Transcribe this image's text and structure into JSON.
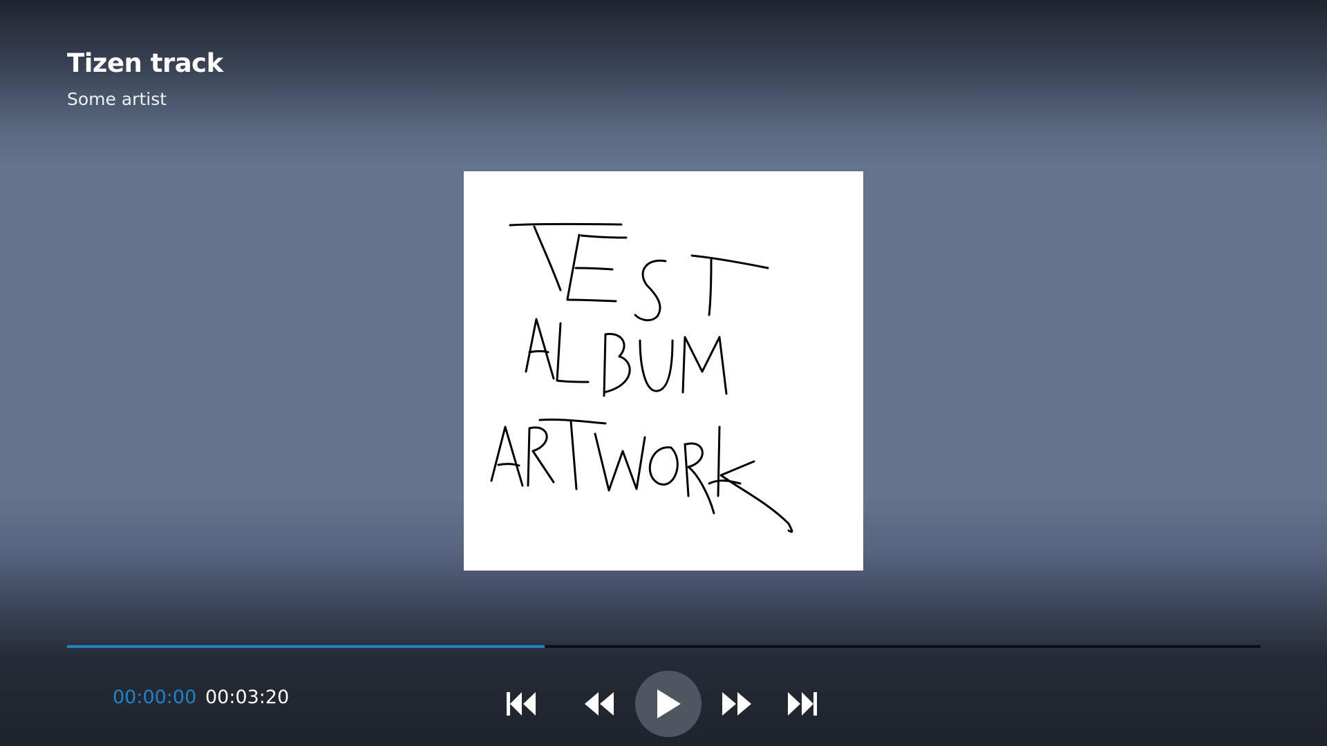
{
  "track": {
    "title": "Tizen track",
    "artist": "Some artist"
  },
  "artwork": {
    "handwritten_text": "TEST ALBUM ARTWORK"
  },
  "progress": {
    "played_fraction": 0.4,
    "current_time": "00:00:00",
    "total_time": "00:03:20"
  },
  "controls": {
    "icons": [
      "skip-previous-icon",
      "rewind-icon",
      "play-icon",
      "fast-forward-icon",
      "skip-next-icon"
    ]
  },
  "colors": {
    "accent": "#1e83c9",
    "track_background": "#0c0f14",
    "play_button_background": "#505661",
    "background_mid": "#64748c",
    "background_dark": "#1f242e"
  }
}
